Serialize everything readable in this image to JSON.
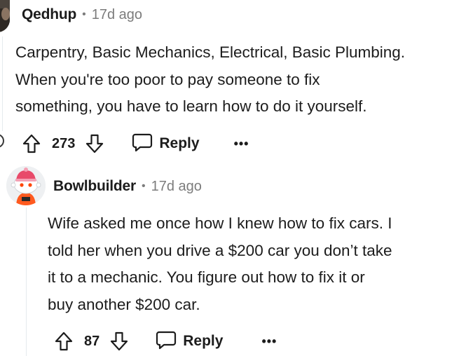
{
  "comments": [
    {
      "username": "Qedhup",
      "separator": "•",
      "time": "17d ago",
      "body_lines": [
        "Carpentry, Basic Mechanics, Electrical, Basic Plumbing.",
        "When you're too poor to pay someone to fix",
        "something, you have to learn how to do it yourself."
      ],
      "votes": "273",
      "reply_label": "Reply",
      "more_label": "•••"
    },
    {
      "username": "Bowlbuilder",
      "separator": "•",
      "time": "17d ago",
      "body_lines": [
        "Wife asked me once how I knew how to fix cars. I",
        "told her when you drive a $200 car you don’t take",
        "it to a mechanic. You figure out how to fix it or",
        "buy another $200 car."
      ],
      "votes": "87",
      "reply_label": "Reply",
      "more_label": "•••"
    }
  ],
  "icons": {
    "upvote": "upvote-arrow-icon",
    "downvote": "downvote-arrow-icon",
    "reply": "speech-bubble-icon",
    "more": "ellipsis-icon",
    "collapse": "collapse-thread-icon"
  },
  "colors": {
    "text": "#1c1c1c",
    "meta": "#7c7c7c",
    "thread_line": "#e5ebee",
    "snoo_hat": "#e84a6a",
    "snoo_body": "#ff5a1f"
  }
}
